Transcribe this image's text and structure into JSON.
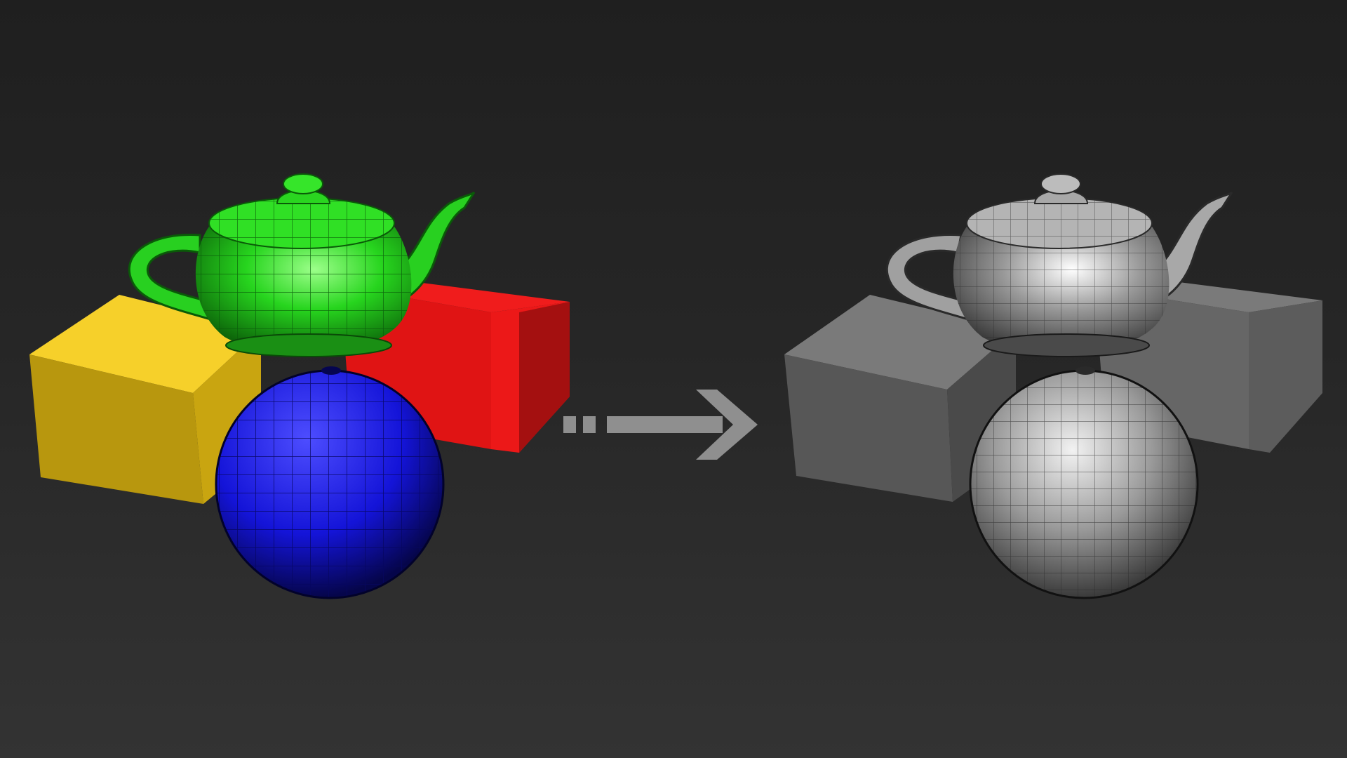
{
  "scene": {
    "background": {
      "top": "#1f1f1f",
      "bottom": "#333333"
    },
    "arrow_color": "#8f8f8f",
    "colored_set": {
      "teapot_color": "#23d21c",
      "sphere_color": "#1818e6",
      "left_box_color": "#f0c21c",
      "right_box_color": "#e81818"
    },
    "gray_set": {
      "teapot_color": "#9a9a9a",
      "sphere_color": "#9a9a9a",
      "left_box_color": "#6a6a6a",
      "right_box_color": "#6a6a6a"
    }
  }
}
